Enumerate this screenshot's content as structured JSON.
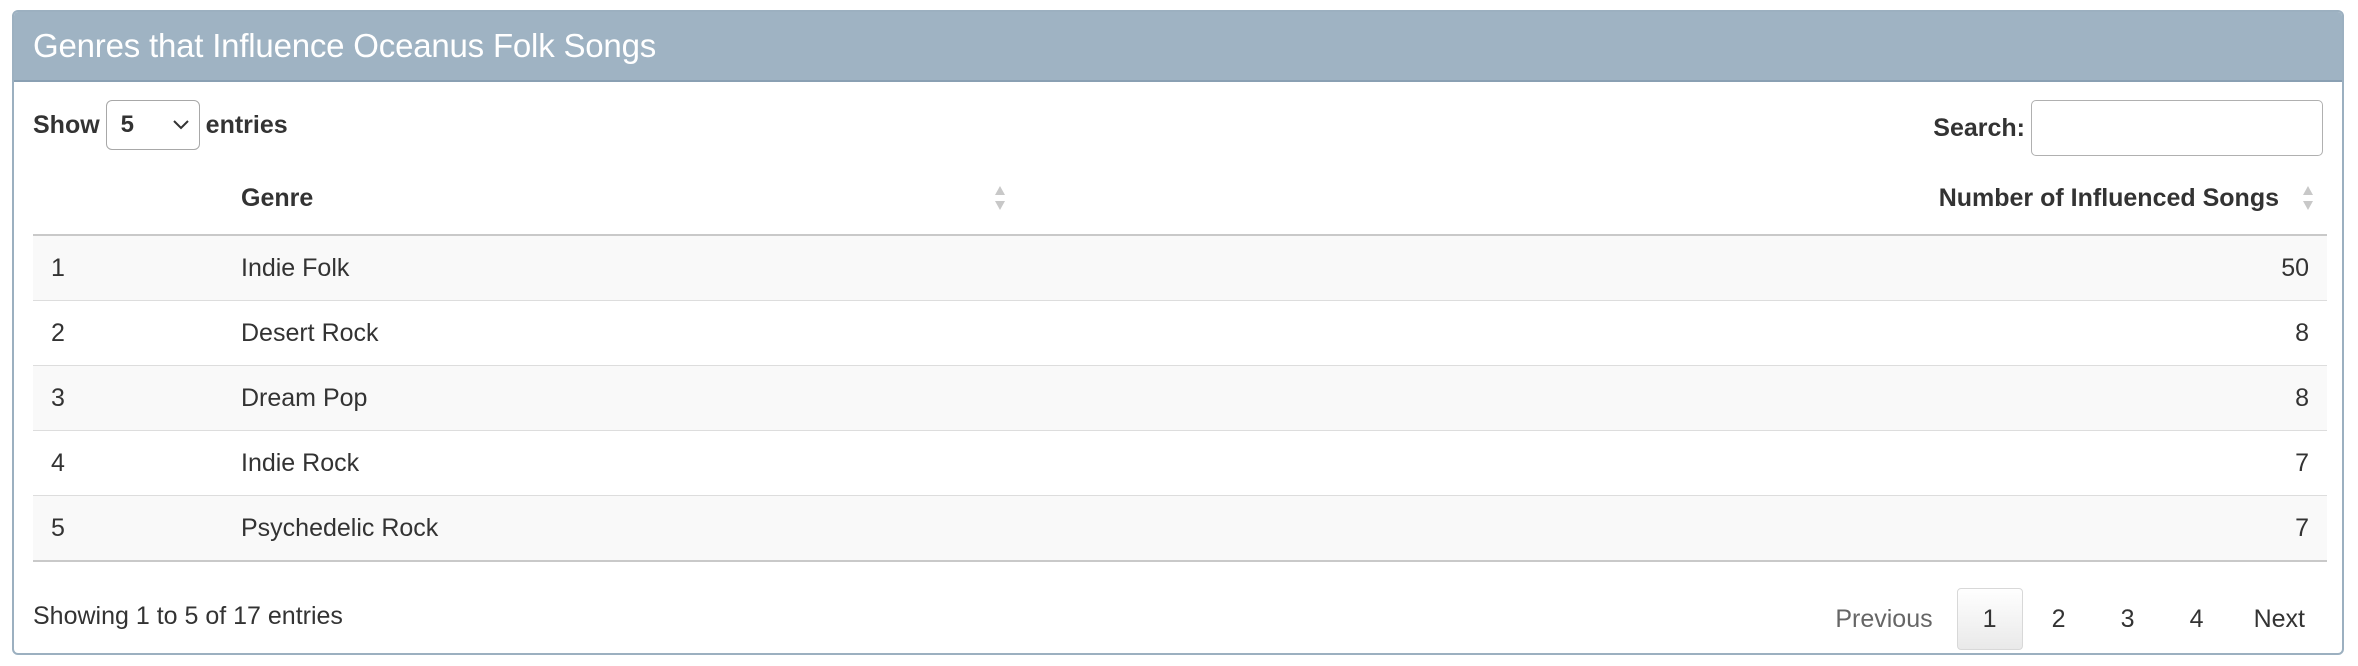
{
  "panel": {
    "title": "Genres that Influence Oceanus Folk Songs"
  },
  "controls": {
    "show_label": "Show",
    "entries_label": "entries",
    "page_length": "5",
    "search_label": "Search:",
    "search_value": ""
  },
  "table": {
    "columns": [
      "",
      "Genre",
      "Number of Influenced Songs"
    ],
    "rows": [
      {
        "index": "1",
        "genre": "Indie Folk",
        "count": "50"
      },
      {
        "index": "2",
        "genre": "Desert Rock",
        "count": "8"
      },
      {
        "index": "3",
        "genre": "Dream Pop",
        "count": "8"
      },
      {
        "index": "4",
        "genre": "Indie Rock",
        "count": "7"
      },
      {
        "index": "5",
        "genre": "Psychedelic Rock",
        "count": "7"
      }
    ]
  },
  "footer": {
    "info": "Showing 1 to 5 of 17 entries",
    "previous_label": "Previous",
    "next_label": "Next",
    "pages": [
      "1",
      "2",
      "3",
      "4"
    ],
    "current_page": "1"
  },
  "icons": {
    "sort": "sort-both-icon",
    "select": "chevron-down-icon"
  }
}
